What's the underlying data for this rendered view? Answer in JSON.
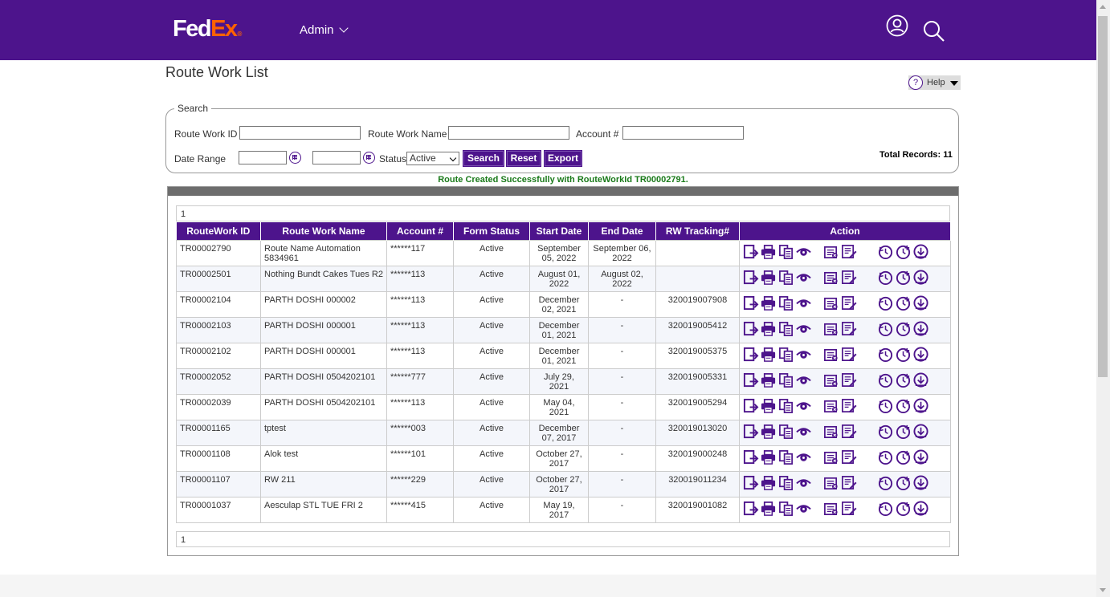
{
  "header": {
    "logo_fed": "Fed",
    "logo_ex": "Ex",
    "logo_reg": "®",
    "admin_label": "Admin",
    "brand_color": "#4d148c",
    "accent_color": "#ff6200"
  },
  "page": {
    "title": "Route Work List",
    "help_label": "Help",
    "help_icon": "?"
  },
  "search": {
    "legend": "Search",
    "route_work_id_label": "Route Work ID",
    "route_work_id_value": "",
    "route_work_name_label": "Route Work Name",
    "route_work_name_value": "",
    "account_label": "Account #",
    "account_value": "",
    "date_range_label": "Date Range",
    "date_from_value": "",
    "date_to_value": "",
    "status_label": "Status",
    "status_value": "Active",
    "search_button": "Search",
    "reset_button": "Reset",
    "export_button": "Export",
    "total_records": "Total Records: 11"
  },
  "message": "Route Created Successfully with RouteWorkId TR00002791.",
  "grid": {
    "page_top": "1",
    "page_bottom": "1",
    "columns": [
      "RouteWork ID",
      "Route Work Name",
      "Account #",
      "Form Status",
      "Start Date",
      "End Date",
      "RW Tracking#",
      "Action"
    ],
    "rows": [
      {
        "id": "TR00002790",
        "name": "Route Name Automation 5834961",
        "account": "******117",
        "status": "Active",
        "start": "September 05, 2022",
        "end": "September 06, 2022",
        "tracking": ""
      },
      {
        "id": "TR00002501",
        "name": "Nothing Bundt Cakes Tues R2",
        "account": "******113",
        "status": "Active",
        "start": "August 01, 2022",
        "end": "August 02, 2022",
        "tracking": ""
      },
      {
        "id": "TR00002104",
        "name": "PARTH DOSHI 000002",
        "account": "******113",
        "status": "Active",
        "start": "December 02, 2021",
        "end": "-",
        "tracking": "320019007908"
      },
      {
        "id": "TR00002103",
        "name": "PARTH DOSHI 000001",
        "account": "******113",
        "status": "Active",
        "start": "December 01, 2021",
        "end": "-",
        "tracking": "320019005412"
      },
      {
        "id": "TR00002102",
        "name": "PARTH DOSHI 000001",
        "account": "******113",
        "status": "Active",
        "start": "December 01, 2021",
        "end": "-",
        "tracking": "320019005375"
      },
      {
        "id": "TR00002052",
        "name": "PARTH DOSHI 0504202101",
        "account": "******777",
        "status": "Active",
        "start": "July 29, 2021",
        "end": "-",
        "tracking": "320019005331"
      },
      {
        "id": "TR00002039",
        "name": "PARTH DOSHI 0504202101",
        "account": "******113",
        "status": "Active",
        "start": "May 04, 2021",
        "end": "-",
        "tracking": "320019005294"
      },
      {
        "id": "TR00001165",
        "name": "tptest",
        "account": "******003",
        "status": "Active",
        "start": "December 07, 2017",
        "end": "-",
        "tracking": "320019013020"
      },
      {
        "id": "TR00001108",
        "name": "Alok test",
        "account": "******101",
        "status": "Active",
        "start": "October 27, 2017",
        "end": "-",
        "tracking": "320019000248"
      },
      {
        "id": "TR00001107",
        "name": "RW 211",
        "account": "******229",
        "status": "Active",
        "start": "October 27, 2017",
        "end": "-",
        "tracking": "320019011234"
      },
      {
        "id": "TR00001037",
        "name": "Aesculap STL TUE FRI 2",
        "account": "******415",
        "status": "Active",
        "start": "May 19, 2017",
        "end": "-",
        "tracking": "320019001082"
      }
    ],
    "action_icons": [
      "export-icon",
      "print-icon",
      "copy-icon",
      "view-icon",
      "list-icon",
      "edit-icon",
      "history-icon",
      "add-schedule-icon",
      "download-icon"
    ]
  }
}
